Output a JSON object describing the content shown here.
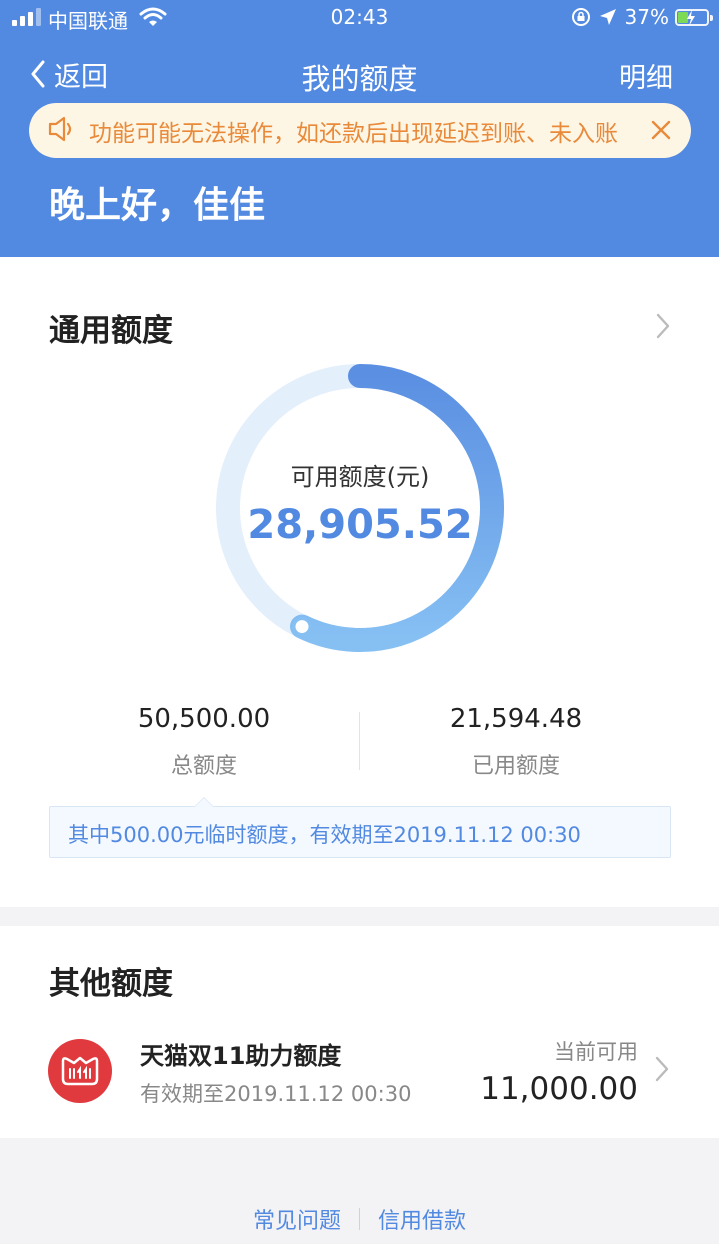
{
  "status_bar": {
    "carrier": "中国联通",
    "time": "02:43",
    "battery": "37%",
    "battery_level": 0.37
  },
  "nav": {
    "back_label": "返回",
    "title": "我的额度",
    "detail_label": "明细"
  },
  "notice": {
    "text": "功能可能无法操作，如还款后出现延迟到账、未入账"
  },
  "greeting": "晚上好，佳佳",
  "general_credit": {
    "title": "通用额度",
    "available_label": "可用额度(元)",
    "available_value": "28,905.52",
    "available_fraction": 0.5724,
    "total_value": "50,500.00",
    "total_label": "总额度",
    "used_value": "21,594.48",
    "used_label": "已用额度",
    "tip": "其中500.00元临时额度，有效期至2019.11.12 00:30"
  },
  "other_credit": {
    "title": "其他额度",
    "item": {
      "name": "天猫双11助力额度",
      "validity": "有效期至2019.11.12 00:30",
      "available_label": "当前可用",
      "available_value": "11,000.00"
    }
  },
  "footer": {
    "faq": "常见问题",
    "loan": "信用借款"
  },
  "colors": {
    "primary": "#5289e1",
    "notice_text": "#e98a3b",
    "brand_red": "#e03a3e"
  }
}
